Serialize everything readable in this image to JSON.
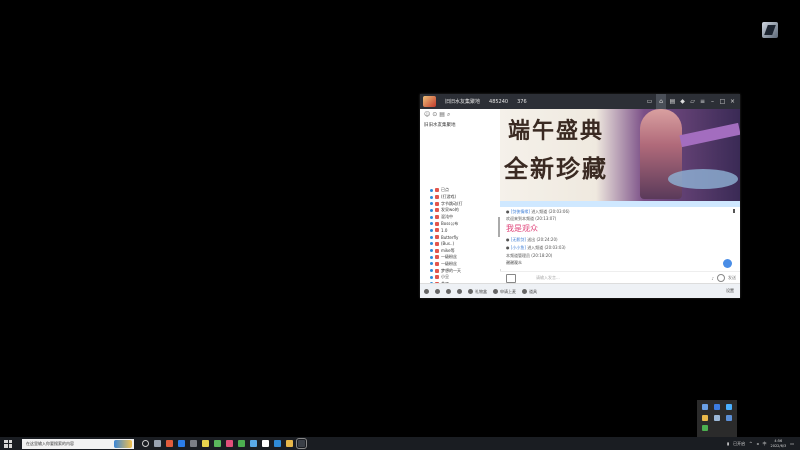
{
  "window": {
    "title_text": "旧旧水友集聚地",
    "room_id": "485240",
    "viewers": "376",
    "left_panel": {
      "channel_title": "旧旧水友集聚地",
      "members": [
        "已点",
        "(打游戏)",
        "字节跳动(打",
        "发呆wo的",
        "混沌中",
        "Boss公布",
        "1.0 ",
        "Butterfly",
        "(Bus..)",
        "mike等",
        "一级粉丝",
        "一级粉丝",
        "梦想的一天",
        "小旦",
        "茶丁"
      ]
    },
    "banner": {
      "line1": "端午盛典",
      "line2": "全新珍藏"
    },
    "chat": {
      "msg1_name": "[剑侠情缘]",
      "msg1_text": "进入频道",
      "msg1_time": "(20:03:06)",
      "msg2_text": "欢迎来到本频道",
      "msg2_time": "(20:13:07)",
      "big_msg": "我是观众",
      "msg3_name": "[无影剑]",
      "msg3_text": "送出",
      "msg3_time": "(20:24:20)",
      "msg4_name": "[小小鱼]",
      "msg4_text": "进入频道",
      "msg4_time": "(20:03:03)",
      "msg5_text": "本频道管理员",
      "msg5_time": "(20:18:20)",
      "msg6_text": "谢谢观众"
    },
    "input": {
      "placeholder": "请输入发言...",
      "right_label": "发送"
    },
    "bottom": {
      "item1": "礼物盒",
      "item2": "申请上麦",
      "item3": "道具",
      "right_label": "设置"
    }
  },
  "taskbar": {
    "search_placeholder": "在这里输入你要搜索的内容",
    "tray_label": "已开启",
    "time": "4:56",
    "date": "2022/6/3"
  }
}
